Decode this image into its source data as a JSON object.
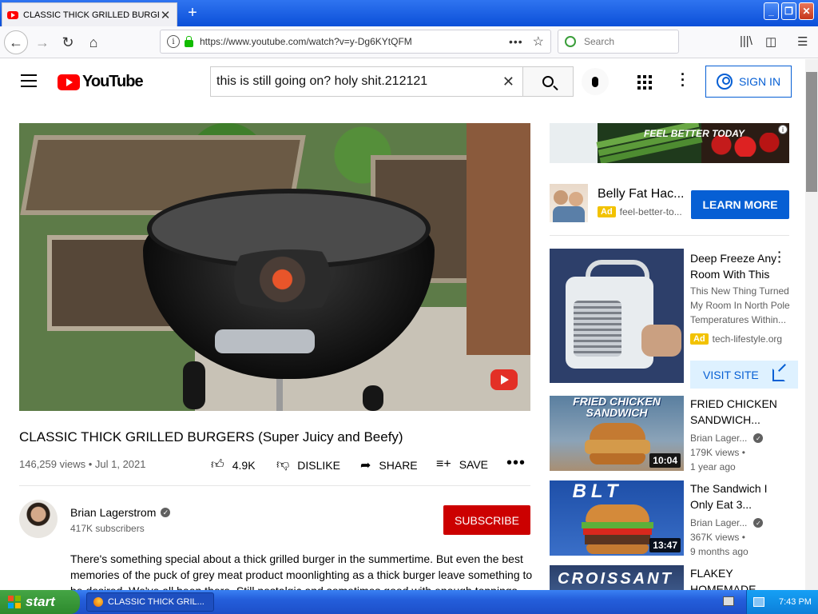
{
  "browser": {
    "tab_title": "CLASSIC THICK GRILLED BURGERS",
    "tab_close": "✕",
    "new_tab": "+",
    "url": "https://www.youtube.com/watch?v=y-Dg6KYtQFM",
    "search_placeholder": "Search",
    "window_min": "_",
    "window_max": "❐",
    "window_close": "✕"
  },
  "youtube": {
    "logo_text": "YouTube",
    "search_query": "this is still going on? holy shit.212121",
    "search_clear": "✕",
    "sign_in": "SIGN IN"
  },
  "video": {
    "title": "CLASSIC THICK GRILLED BURGERS (Super Juicy and Beefy)",
    "meta": "146,259 views • Jul 1, 2021",
    "actions": {
      "like": "4.9K",
      "dislike": "DISLIKE",
      "share": "SHARE",
      "save": "SAVE",
      "more": "•••"
    },
    "channel": {
      "name": "Brian Lagerstrom",
      "subscribers": "417K subscribers",
      "subscribe": "SUBSCRIBE"
    },
    "description": "There's something special about a thick grilled burger in the summertime. But even the best memories of the puck of grey meat product moonlighting as a thick burger leave something to be desired. We've all been there. Still nostalgic and sometimes good with enough toppings..."
  },
  "sidebar": {
    "banner_ad": {
      "text": "FEEL BETTER TODAY",
      "info": "i"
    },
    "ad_compact": {
      "title": "Belly Fat Hac...",
      "tag": "Ad",
      "domain": "feel-better-to...",
      "cta": "LEARN MORE"
    },
    "ad_large": {
      "title": "Deep Freeze Any Room With This",
      "description": "This New Thing Turned My Room In North Pole Temperatures Within...",
      "tag": "Ad",
      "domain": "tech-lifestyle.org",
      "cta": "VISIT SITE"
    },
    "recommendations": [
      {
        "thumb_caption": "FRIED CHICKEN SANDWICH",
        "title": "FRIED CHICKEN SANDWICH...",
        "channel": "Brian Lager...",
        "views": "179K views •",
        "age": "1 year ago",
        "duration": "10:04"
      },
      {
        "thumb_caption": "BLT",
        "title": "The Sandwich I Only Eat 3...",
        "channel": "Brian Lager...",
        "views": "367K views •",
        "age": "9 months ago",
        "duration": "13:47"
      },
      {
        "thumb_caption": "CROISSANT",
        "title": "FLAKEY HOMEMADE"
      }
    ]
  },
  "taskbar": {
    "start": "start",
    "task": "CLASSIC THICK GRIL...",
    "clock": "7:43 PM"
  },
  "colors": {
    "youtube_red": "#ff0000",
    "link_blue": "#065fd4",
    "subscribe_red": "#cc0000",
    "taskbar_blue": "#245edb",
    "start_green": "#2d8a2d"
  }
}
